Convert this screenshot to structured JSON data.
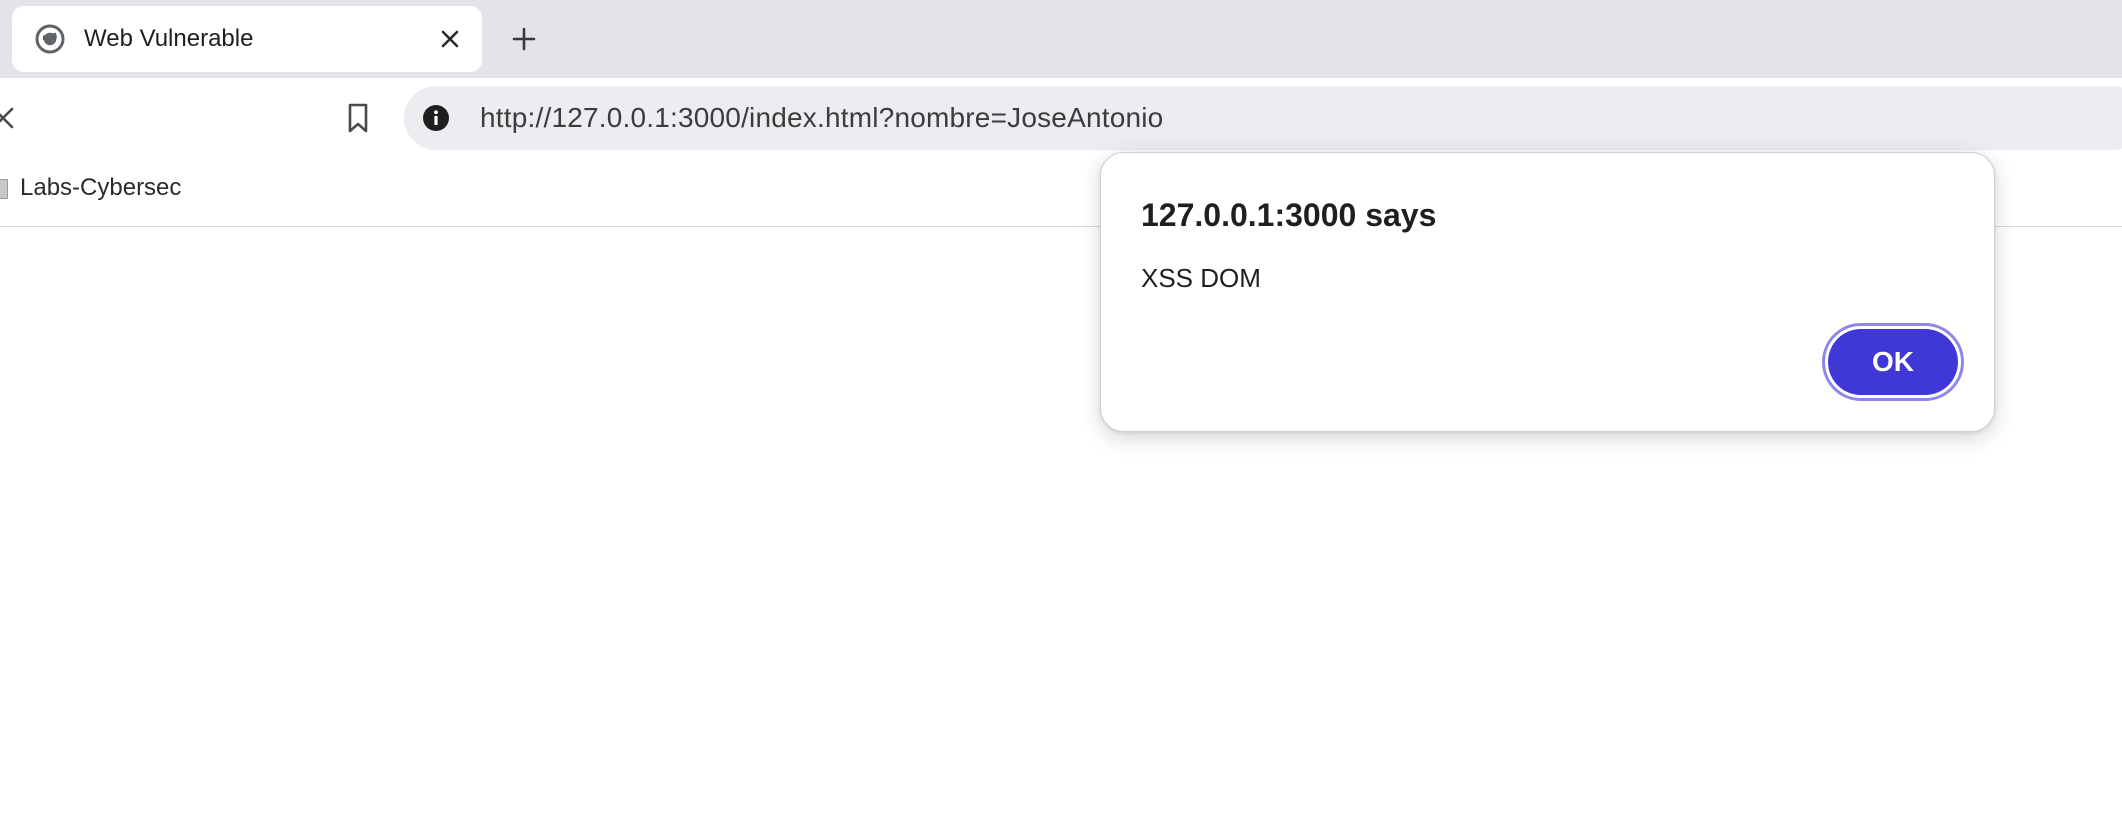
{
  "browser": {
    "tab": {
      "title": "Web Vulnerable",
      "favicon": "globe-icon",
      "close_icon": "close-icon"
    },
    "new_tab_icon": "plus-icon",
    "toolbar": {
      "stop_icon": "close-icon",
      "bookmark_icon": "bookmark-icon",
      "site_info_icon": "info-icon",
      "url": "http://127.0.0.1:3000/index.html?nombre=JoseAntonio"
    },
    "bookmarks_bar": {
      "items": [
        {
          "label": "Labs-Cybersec",
          "icon": "folder-icon"
        }
      ]
    }
  },
  "alert_dialog": {
    "title": "127.0.0.1:3000 says",
    "message": "XSS DOM",
    "ok_label": "OK"
  },
  "colors": {
    "tabstrip": "#e3e3e8",
    "omnibox": "#ececf1",
    "ok_button": "#3f37d6",
    "ok_focus_ring": "#8e87e8"
  }
}
